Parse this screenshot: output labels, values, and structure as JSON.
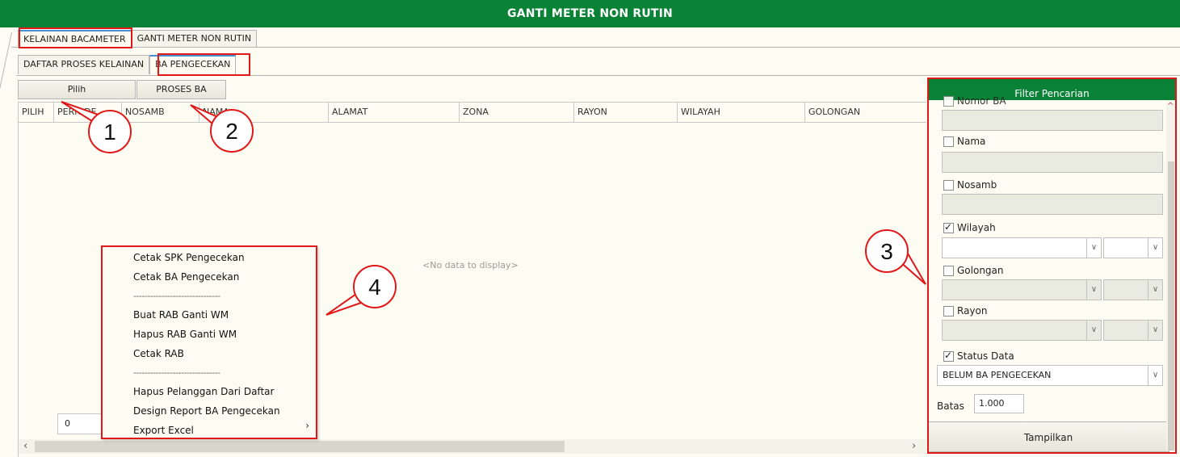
{
  "window": {
    "title": "GANTI METER NON RUTIN"
  },
  "top_tabs": [
    {
      "label": "KELAINAN BACAMETER",
      "active": true
    },
    {
      "label": "GANTI METER NON RUTIN",
      "active": false
    }
  ],
  "sub_tabs": [
    {
      "label": "DAFTAR PROSES KELAINAN",
      "active": false
    },
    {
      "label": "BA PENGECEKAN",
      "active": true
    }
  ],
  "toolbar": {
    "pilih_label": "Pilih",
    "proses_ba_label": "PROSES BA"
  },
  "grid": {
    "columns": [
      "PILIH",
      "PERIODE",
      "NOSAMB",
      "NAMA",
      "ALAMAT",
      "ZONA",
      "RAYON",
      "WILAYAH",
      "GOLONGAN"
    ],
    "empty_text": "<No data to display>",
    "pager_value": "0"
  },
  "context_menu": {
    "items": [
      {
        "label": "Cetak SPK Pengecekan"
      },
      {
        "label": "Cetak BA Pengecekan"
      },
      {
        "label": "-------------------------------"
      },
      {
        "label": "Buat RAB Ganti WM"
      },
      {
        "label": "Hapus RAB Ganti WM"
      },
      {
        "label": "Cetak RAB"
      },
      {
        "label": "-------------------------------"
      },
      {
        "label": "Hapus Pelanggan Dari Daftar"
      },
      {
        "label": "Design Report BA Pengecekan"
      },
      {
        "label": "Export Excel"
      }
    ],
    "submenu_arrow": "›"
  },
  "filter": {
    "title": "Filter Pencarian",
    "nomor_ba_label": "Nomor BA",
    "nama_label": "Nama",
    "nosamb_label": "Nosamb",
    "wilayah_label": "Wilayah",
    "golongan_label": "Golongan",
    "rayon_label": "Rayon",
    "status_label": "Status Data",
    "status_value": "BELUM BA PENGECEKAN",
    "batas_label": "Batas",
    "batas_value": "1.000",
    "tampilkan_label": "Tampilkan",
    "wilayah_checked": true,
    "status_checked": true
  },
  "callouts": [
    "1",
    "2",
    "3",
    "4"
  ],
  "icons": {
    "dropdown": "chevron-down-icon",
    "check": "check-icon",
    "scroll_left": "chevron-left-icon",
    "scroll_right": "chevron-right-icon"
  },
  "colors": {
    "header_green": "#0a8236",
    "highlight_red": "#e01818",
    "background": "#fdfcf3"
  }
}
